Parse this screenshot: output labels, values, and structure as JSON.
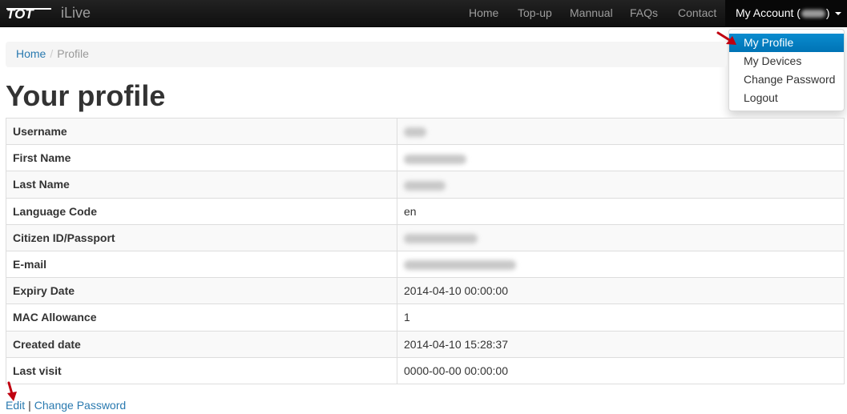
{
  "navbar": {
    "brand_logo_text": "TOT",
    "brand_name": "iLive",
    "links": [
      "Home",
      "Top-up",
      "Mannual",
      "FAQs",
      "Contact"
    ],
    "account_label_prefix": "My Account (",
    "account_label_suffix": ")"
  },
  "dropdown": {
    "items": [
      "My Profile",
      "My Devices",
      "Change Password",
      "Logout"
    ],
    "active_index": 0
  },
  "breadcrumb": {
    "home": "Home",
    "separator": "/",
    "current": "Profile"
  },
  "page_title": "Your profile",
  "profile": {
    "rows": [
      {
        "label": "Username",
        "value": "",
        "redacted": true
      },
      {
        "label": "First Name",
        "value": "",
        "redacted": true
      },
      {
        "label": "Last Name",
        "value": "",
        "redacted": true
      },
      {
        "label": "Language Code",
        "value": "en",
        "redacted": false
      },
      {
        "label": "Citizen ID/Passport",
        "value": "",
        "redacted": true
      },
      {
        "label": "E-mail",
        "value": "",
        "redacted": true
      },
      {
        "label": "Expiry Date",
        "value": "2014-04-10 00:00:00",
        "redacted": false
      },
      {
        "label": "MAC Allowance",
        "value": "1",
        "redacted": false
      },
      {
        "label": "Created date",
        "value": "2014-04-10 15:28:37",
        "redacted": false
      },
      {
        "label": "Last visit",
        "value": "0000-00-00 00:00:00",
        "redacted": false
      }
    ]
  },
  "footer": {
    "edit_label": "Edit",
    "separator": "|",
    "change_password_label": "Change Password"
  },
  "colors": {
    "navbar_bg": "#111111",
    "link": "#2a7ab0",
    "dropdown_active": "#0a84c6",
    "annotation_arrow": "#c00010"
  }
}
